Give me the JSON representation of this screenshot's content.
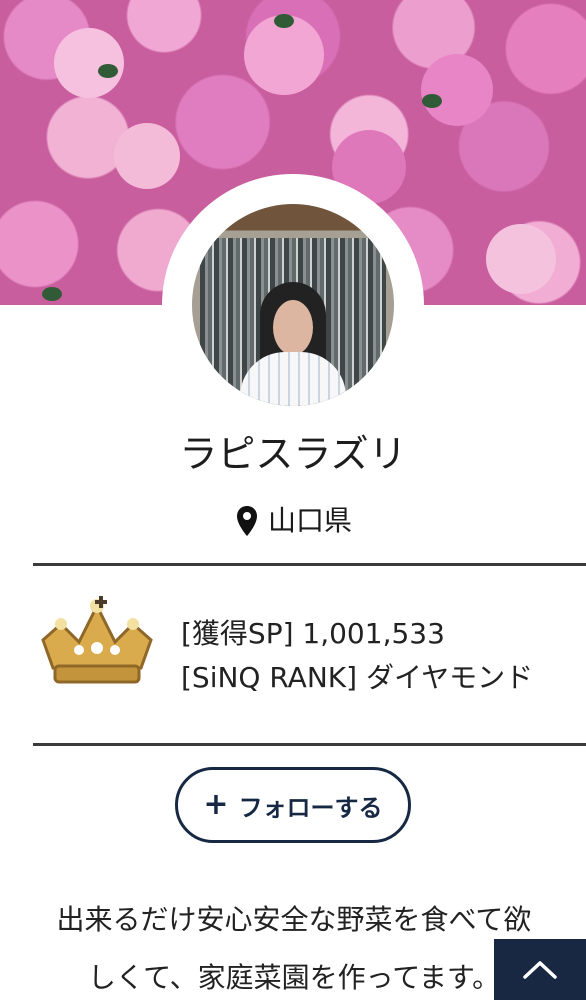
{
  "profile": {
    "name": "ラピスラズリ",
    "location": "山口県",
    "avatar_alt": "profile-photo"
  },
  "stats": {
    "points_line": "[獲得SP] 1,001,533",
    "rank_line": "[SiNQ RANK] ダイヤモンド"
  },
  "follow": {
    "label": "フォローする",
    "icon": "plus-icon"
  },
  "bio": {
    "line1": "出来るだけ安心安全な野菜を食べて欲",
    "line2": "しくて、家庭菜園を作ってます。"
  },
  "icons": {
    "location": "location-pin-icon",
    "rank": "crown-icon",
    "back_to_top": "chevron-up-icon"
  },
  "colors": {
    "accent_navy": "#172844",
    "rule_gray": "#3b3b3b",
    "cover_pink": "#e58ac7"
  }
}
